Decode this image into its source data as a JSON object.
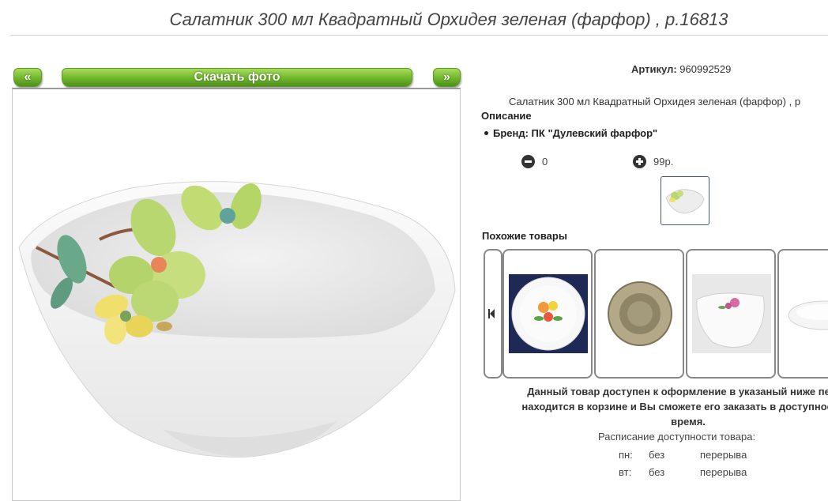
{
  "title": "Салатник 300 мл Квадратный Орхидея зеленая (фарфор) , р.16813",
  "gallery": {
    "prev_label": "«",
    "download_label": "Скачать фото",
    "next_label": "»"
  },
  "product": {
    "sku_label": "Артикул:",
    "sku_value": "960992529",
    "short_description": "Салатник 300 мл Квадратный Орхидея зеленая (фарфор) , р",
    "description_heading": "Описание",
    "brand_text": "Бренд: ПК \"Дулевский фарфор\"",
    "quantity": "0",
    "price": "99р."
  },
  "similar": {
    "heading": "Похожие товары"
  },
  "availability": {
    "line1": "Данный товар доступен к оформление в указаный ниже перио",
    "line2": "находится в корзине и Вы сможете его заказать в доступное для",
    "line3": "время.",
    "schedule_heading": "Расписание доступности товара:",
    "rows": [
      {
        "day": "пн:",
        "from": "без",
        "to": "перерыва"
      },
      {
        "day": "вт:",
        "from": "без",
        "to": "перерыва"
      }
    ]
  },
  "colors": {
    "button_green": "#6fb52c",
    "text": "#333333"
  }
}
